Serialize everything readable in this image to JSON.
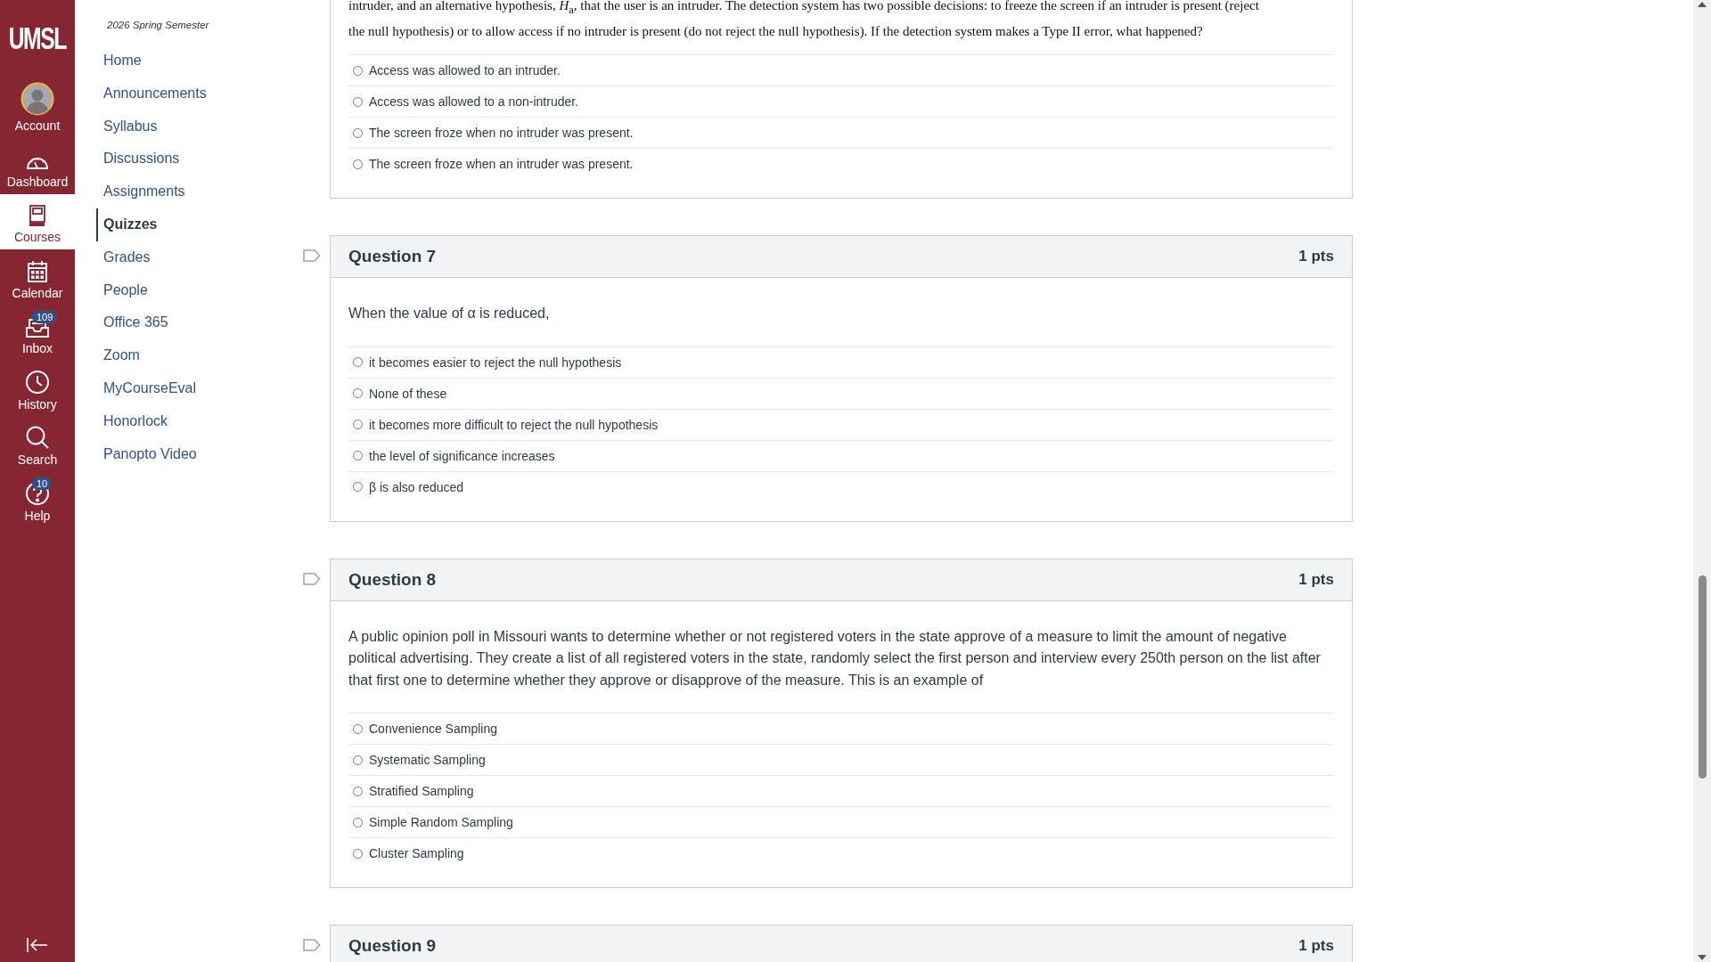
{
  "global_nav": {
    "logo": "UMSL",
    "items": [
      {
        "kind": "account",
        "label": "Account",
        "selected": false
      },
      {
        "kind": "dashboard",
        "label": "Dashboard",
        "selected": false
      },
      {
        "kind": "courses",
        "label": "Courses",
        "selected": true
      },
      {
        "kind": "calendar",
        "label": "Calendar",
        "selected": false
      },
      {
        "kind": "inbox",
        "label": "Inbox",
        "selected": false,
        "badge": "109"
      },
      {
        "kind": "history",
        "label": "History",
        "selected": false
      },
      {
        "kind": "search",
        "label": "Search",
        "selected": false
      },
      {
        "kind": "help",
        "label": "Help",
        "selected": false,
        "badge": "10"
      }
    ]
  },
  "course_nav": {
    "term": "2026 Spring Semester",
    "items": [
      {
        "label": "Home",
        "selected": false
      },
      {
        "label": "Announcements",
        "selected": false
      },
      {
        "label": "Syllabus",
        "selected": false
      },
      {
        "label": "Discussions",
        "selected": false
      },
      {
        "label": "Assignments",
        "selected": false
      },
      {
        "label": "Quizzes",
        "selected": true
      },
      {
        "label": "Grades",
        "selected": false
      },
      {
        "label": "People",
        "selected": false
      },
      {
        "label": "Office 365",
        "selected": false
      },
      {
        "label": "Zoom",
        "selected": false
      },
      {
        "label": "MyCourseEval",
        "selected": false
      },
      {
        "label": "Honorlock",
        "selected": false
      },
      {
        "label": "Panopto Video",
        "selected": false
      }
    ]
  },
  "questions": [
    {
      "kind": "continued",
      "prompt": [
        "intruder, and an alternative hypothesis, *H*$_{a}$, that the user is an intruder. The detection system has two possible decisions: to freeze the screen if an intruder is present (reject",
        "the null hypothesis) or to allow access if no intruder is present (do not reject the null hypothesis). If the detection system makes a Type II error, what happened?"
      ],
      "options": [
        {
          "label": "Access was allowed to an intruder.",
          "selected": false
        },
        {
          "label": "Access was allowed to a non-intruder.",
          "selected": false
        },
        {
          "label": "The screen froze when no intruder was present.",
          "selected": false
        },
        {
          "label": "The screen froze when an intruder was present.",
          "selected": false
        }
      ]
    },
    {
      "kind": "full",
      "title": "Question 7",
      "points": "1 pts",
      "prompt": [
        "When the value of α is reduced,"
      ],
      "options": [
        {
          "label": "it becomes easier to reject the null hypothesis",
          "selected": false
        },
        {
          "label": "None of these",
          "selected": false
        },
        {
          "label": "it becomes more difficult to reject the null hypothesis",
          "selected": false
        },
        {
          "label": "the level of significance increases",
          "selected": false
        },
        {
          "label": "β is also reduced",
          "selected": false
        }
      ]
    },
    {
      "kind": "full",
      "title": "Question 8",
      "points": "1 pts",
      "prompt": [
        "A public opinion poll in Missouri wants to determine whether or not registered voters in the state approve of a measure to limit the amount of negative political advertising. They create a list of all registered voters in the state, randomly select the first person and interview every 250th person on the list after that first one to determine whether they approve or disapprove of the measure. This is an example of"
      ],
      "options": [
        {
          "label": "Convenience Sampling",
          "selected": false
        },
        {
          "label": "Systematic Sampling",
          "selected": false
        },
        {
          "label": "Stratified Sampling",
          "selected": false
        },
        {
          "label": "Simple Random Sampling",
          "selected": false
        },
        {
          "label": "Cluster Sampling",
          "selected": false
        }
      ]
    },
    {
      "kind": "full",
      "title": "Question 9",
      "points": "1 pts"
    }
  ]
}
